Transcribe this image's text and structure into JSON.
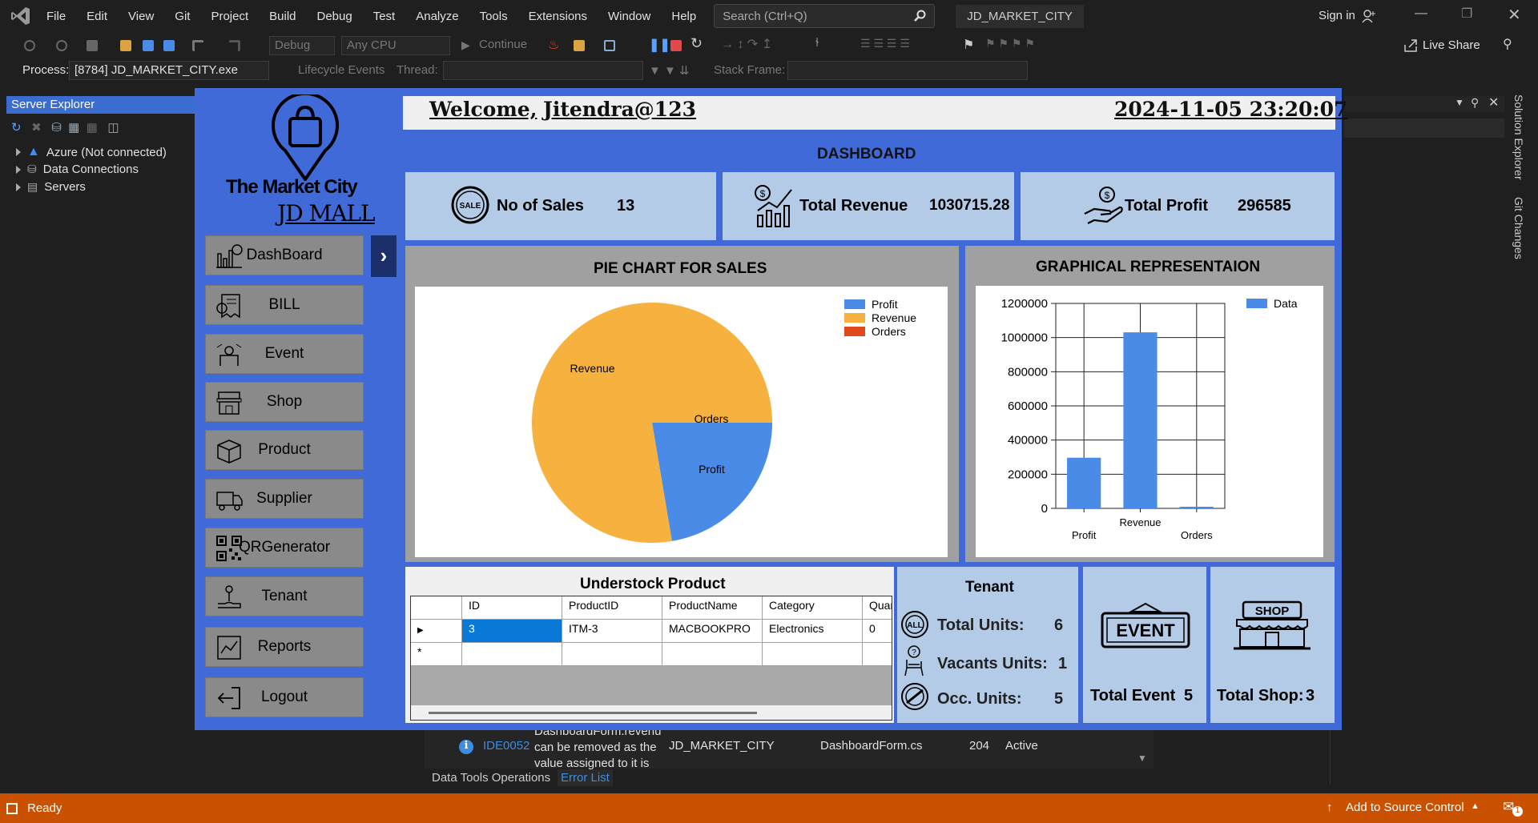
{
  "vs": {
    "menus": [
      "File",
      "Edit",
      "View",
      "Git",
      "Project",
      "Build",
      "Debug",
      "Test",
      "Analyze",
      "Tools",
      "Extensions",
      "Window",
      "Help"
    ],
    "search_placeholder": "Search (Ctrl+Q)",
    "project_title": "JD_MARKET_CITY",
    "sign_in": "Sign in",
    "live_share": "Live Share",
    "config": "Debug",
    "platform": "Any CPU",
    "continue": "Continue",
    "process_label": "Process:",
    "process_value": "[8784] JD_MARKET_CITY.exe",
    "lifecycle": "Lifecycle Events",
    "thread_label": "Thread:",
    "stack_label": "Stack Frame:"
  },
  "server_explorer": {
    "title": "Server Explorer",
    "items": [
      "Azure (Not connected)",
      "Data Connections",
      "Servers"
    ]
  },
  "side_tabs": [
    "Solution Explorer",
    "Git Changes"
  ],
  "error_list": {
    "code": "IDE0052",
    "desc_lines": [
      "DashboardForm.revenu",
      "can be removed as the",
      "value assigned to it is"
    ],
    "project": "JD_MARKET_CITY",
    "file": "DashboardForm.cs",
    "line": "204",
    "state": "Active",
    "tabs": [
      "Data Tools Operations",
      "Error List"
    ]
  },
  "status": {
    "ready": "Ready",
    "source_control": "Add to Source Control",
    "notif_count": "1"
  },
  "app": {
    "welcome": "Welcome,",
    "user": "Jitendra@123",
    "datetime": "2024-11-05 23:20:07",
    "logo_line1": "The Market City",
    "logo_line2": "JD MALL",
    "nav": [
      "DashBoard",
      "BILL",
      "Event",
      "Shop",
      "Product",
      "Supplier",
      "QRGenerator",
      "Tenant",
      "Reports",
      "Logout"
    ],
    "dashboard_title": "DASHBOARD",
    "cards": {
      "sales_label": "No of Sales",
      "sales_value": "13",
      "revenue_label": "Total Revenue",
      "revenue_value": "1030715.28",
      "profit_label": "Total Profit",
      "profit_value": "296585",
      "sale_badge": "SALE"
    },
    "pie_title": "PIE CHART FOR SALES",
    "bar_title": "GRAPHICAL REPRESENTAION",
    "understock": {
      "title": "Understock Product",
      "columns": [
        "ID",
        "ProductID",
        "ProductName",
        "Category",
        "Quan"
      ],
      "rows": [
        [
          "3",
          "ITM-3",
          "MACBOOKPRO",
          "Electronics",
          "0"
        ]
      ]
    },
    "tenant": {
      "title": "Tenant",
      "total_label": "Total Units:",
      "total_value": "6",
      "vacant_label": "Vacants Units:",
      "vacant_value": "1",
      "occ_label": "Occ. Units:",
      "occ_value": "5",
      "all_badge": "ALL"
    },
    "event_card": {
      "sign": "EVENT",
      "label": "Total Event",
      "value": "5"
    },
    "shop_card": {
      "sign": "SHOP",
      "label": "Total Shop:",
      "value": "3"
    }
  },
  "chart_data": [
    {
      "type": "pie",
      "title": "PIE CHART FOR SALES",
      "categories": [
        "Profit",
        "Revenue",
        "Orders"
      ],
      "values": [
        296585,
        1030715.28,
        13
      ],
      "colors": [
        "#4a8be8",
        "#f6b13f",
        "#e0491c"
      ],
      "legend": "top-right"
    },
    {
      "type": "bar",
      "title": "GRAPHICAL REPRESENTAION",
      "categories": [
        "Profit",
        "Revenue",
        "Orders"
      ],
      "series": [
        {
          "name": "Data",
          "values": [
            296585,
            1030715.28,
            13
          ]
        }
      ],
      "ylim": [
        0,
        1200000
      ],
      "yticks": [
        0,
        200000,
        400000,
        600000,
        800000,
        1000000,
        1200000
      ],
      "grid": true,
      "legend": "top-right",
      "color": "#4a8be8"
    }
  ]
}
